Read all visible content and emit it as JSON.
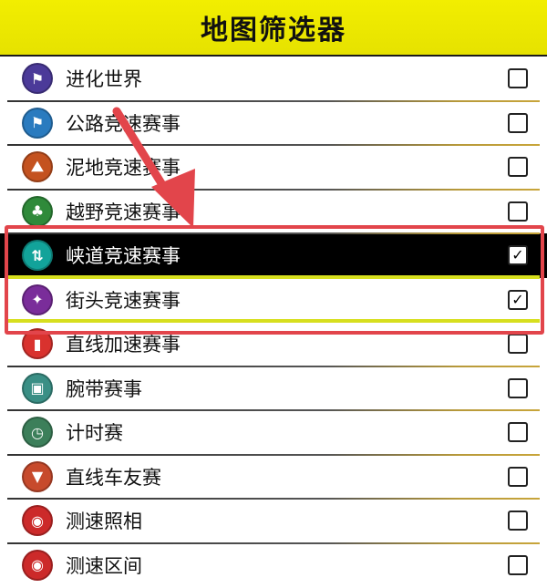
{
  "header": {
    "title": "地图筛选器"
  },
  "items": [
    {
      "label": "进化世界",
      "icon": "evolution-flag-icon",
      "color": "#4b3a99",
      "glyph": "⚑",
      "checked": false
    },
    {
      "label": "公路竞速赛事",
      "icon": "road-race-flag-icon",
      "color": "#2a7bbf",
      "glyph": "⚑",
      "checked": false
    },
    {
      "label": "泥地竞速赛事",
      "icon": "dirt-race-icon",
      "color": "#c4521f",
      "glyph": "⛰",
      "checked": false
    },
    {
      "label": "越野竞速赛事",
      "icon": "cross-country-tree-icon",
      "color": "#2f8a3a",
      "glyph": "♣",
      "checked": false
    },
    {
      "label": "峡道竞速赛事",
      "icon": "canyon-race-icon",
      "color": "#12a39a",
      "glyph": "⇅",
      "checked": true
    },
    {
      "label": "街头竞速赛事",
      "icon": "street-race-icon",
      "color": "#7a2d9a",
      "glyph": "✦",
      "checked": true
    },
    {
      "label": "直线加速赛事",
      "icon": "drag-race-icon",
      "color": "#d9322e",
      "glyph": "▮",
      "checked": false
    },
    {
      "label": "腕带赛事",
      "icon": "wristband-event-icon",
      "color": "#3a8f85",
      "glyph": "▣",
      "checked": false
    },
    {
      "label": "计时赛",
      "icon": "stopwatch-icon",
      "color": "#3c7f5a",
      "glyph": "◷",
      "checked": false
    },
    {
      "label": "直线车友赛",
      "icon": "drag-meetup-lights-icon",
      "color": "#c74a2c",
      "glyph": "▼",
      "checked": false
    },
    {
      "label": "测速照相",
      "icon": "speed-camera-icon",
      "color": "#cc2a2a",
      "glyph": "◉",
      "checked": false
    },
    {
      "label": "测速区间",
      "icon": "speed-zone-icon",
      "color": "#cc2a2a",
      "glyph": "◉",
      "checked": false
    }
  ],
  "check_glyph": "✓"
}
